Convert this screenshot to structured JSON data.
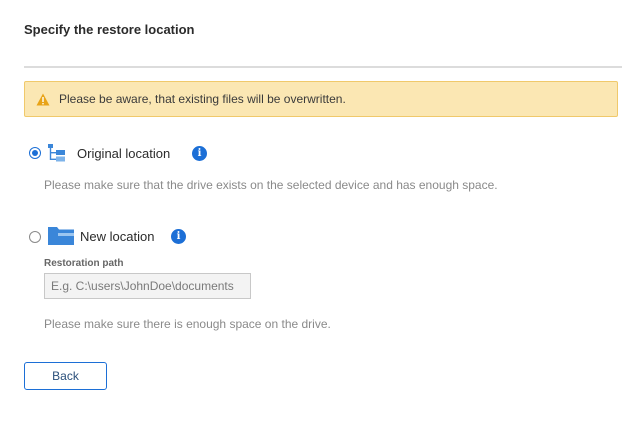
{
  "dialog": {
    "title": "Specify the restore location",
    "warning": {
      "icon": "warning-icon",
      "text": "Please be aware, that existing files will be overwritten."
    },
    "options": [
      {
        "label": "Original location",
        "selected": true,
        "icon": "tree-structure-icon",
        "hint": "Please make sure that the drive exists on the selected device and has enough space."
      },
      {
        "label": "New location",
        "selected": false,
        "icon": "folder-icon",
        "field_label": "Restoration path",
        "field_placeholder": "E.g. C:\\users\\JohnDoe\\documents",
        "hint": "Please make sure there is enough space on the drive."
      }
    ],
    "back_label": "Back"
  },
  "colors": {
    "accent": "#1c6fd6",
    "warning_bg": "#fbe7b3",
    "warning_icon": "#e8a317",
    "folder": "#3a86d9"
  }
}
